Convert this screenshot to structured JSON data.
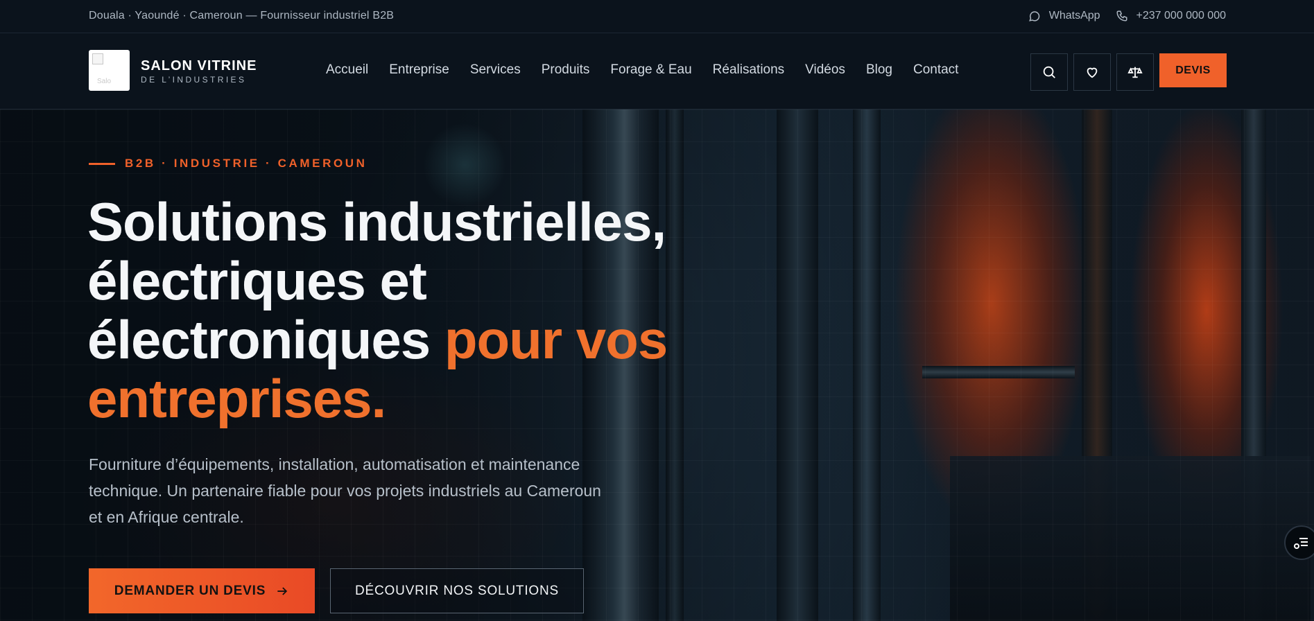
{
  "topbar": {
    "location_text": "Douala · Yaoundé · Cameroun — Fournisseur industriel B2B",
    "whatsapp_label": "WhatsApp",
    "phone": "+237 000 000 000"
  },
  "header": {
    "logo_alt": "Salo",
    "brand_name": "SALON VITRINE",
    "brand_sub": "DE L’INDUSTRIES",
    "nav": [
      {
        "label": "Accueil"
      },
      {
        "label": "Entreprise"
      },
      {
        "label": "Services"
      },
      {
        "label": "Produits"
      },
      {
        "label": "Forage & Eau"
      },
      {
        "label": "Réalisations"
      },
      {
        "label": "Vidéos"
      },
      {
        "label": "Blog"
      },
      {
        "label": "Contact"
      }
    ],
    "devis_label": "DEVIS"
  },
  "hero": {
    "eyebrow": "B2B · INDUSTRIE · CAMEROUN",
    "headline_line1": "Solutions industrielles,",
    "headline_line2": "électriques et",
    "headline_line3a": "électroniques ",
    "headline_line3b": "pour vos",
    "headline_line4": "entreprises.",
    "lead": "Fourniture d’équipements, installation, automatisation et maintenance technique. Un partenaire fiable pour vos projets industriels au Cameroun et en Afrique centrale.",
    "cta_primary": "DEMANDER UN DEVIS",
    "cta_secondary": "DÉCOUVRIR NOS SOLUTIONS"
  },
  "colors": {
    "accent": "#f0612a",
    "background": "#0b131c"
  },
  "icons": [
    "whatsapp-icon",
    "phone-icon",
    "search-icon",
    "heart-icon",
    "scale-icon",
    "arrow-right-icon",
    "accessibility-icon"
  ]
}
